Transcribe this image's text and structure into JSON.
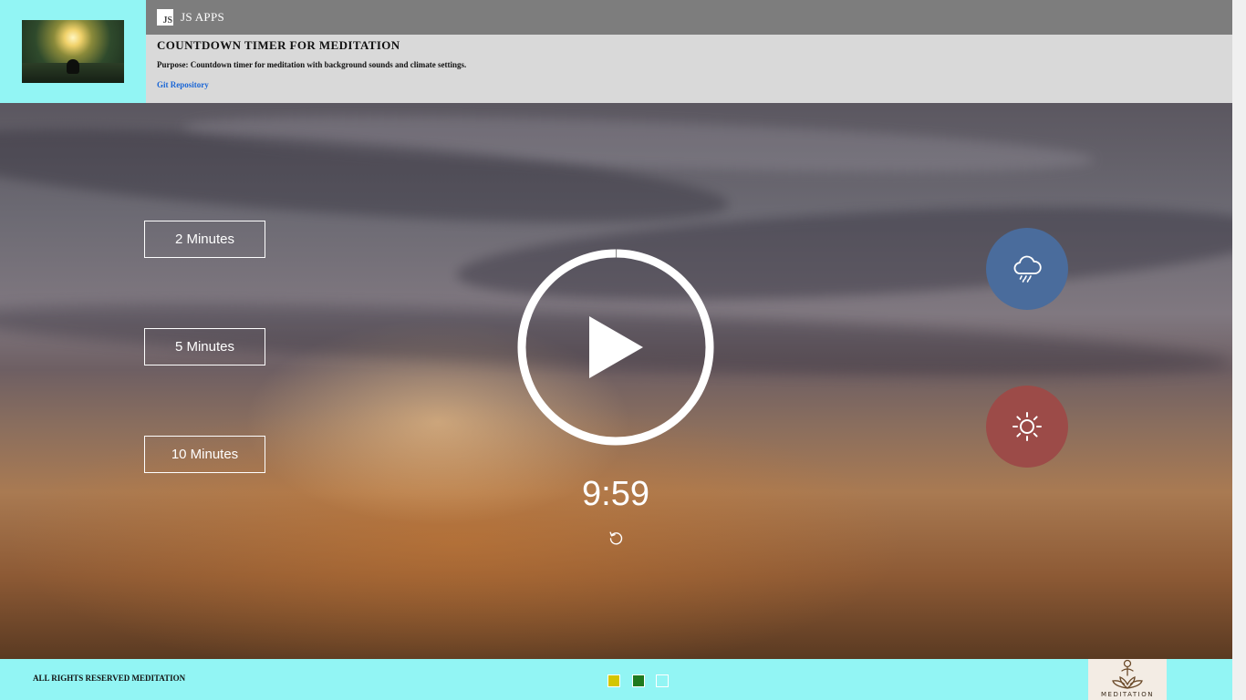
{
  "header": {
    "topbar_title": "JS APPS",
    "badge_text": "JS",
    "app_title": "COUNTDOWN TIMER FOR MEDITATION",
    "purpose": "Purpose: Countdown timer for meditation with background sounds and climate settings.",
    "repo_link": "Git Repository",
    "logo_icon": "meditation-forest-thumbnail"
  },
  "durations": [
    {
      "label": "2 Minutes"
    },
    {
      "label": "5 Minutes"
    },
    {
      "label": "10 Minutes"
    }
  ],
  "player": {
    "state_icon": "play-icon",
    "time": "9:59",
    "progress": 0.0017,
    "reset_icon": "reset-icon"
  },
  "sounds": [
    {
      "name": "rain",
      "icon": "rain-cloud-icon",
      "color": "#4a6c9c"
    },
    {
      "name": "summer",
      "icon": "sun-icon",
      "color": "#9c4b48"
    }
  ],
  "footer": {
    "copyright": "ALL RIGHTS RESERVED MEDITATION",
    "swatches": [
      "#d4c600",
      "#1f7a1f",
      "#92f5f4"
    ],
    "brand_text": "MEDITATION"
  },
  "colors": {
    "accent_cyan": "#92f5f4",
    "topbar_gray": "#7d7d7d",
    "info_gray": "#d9d9d9",
    "link_blue": "#1a66d6"
  }
}
